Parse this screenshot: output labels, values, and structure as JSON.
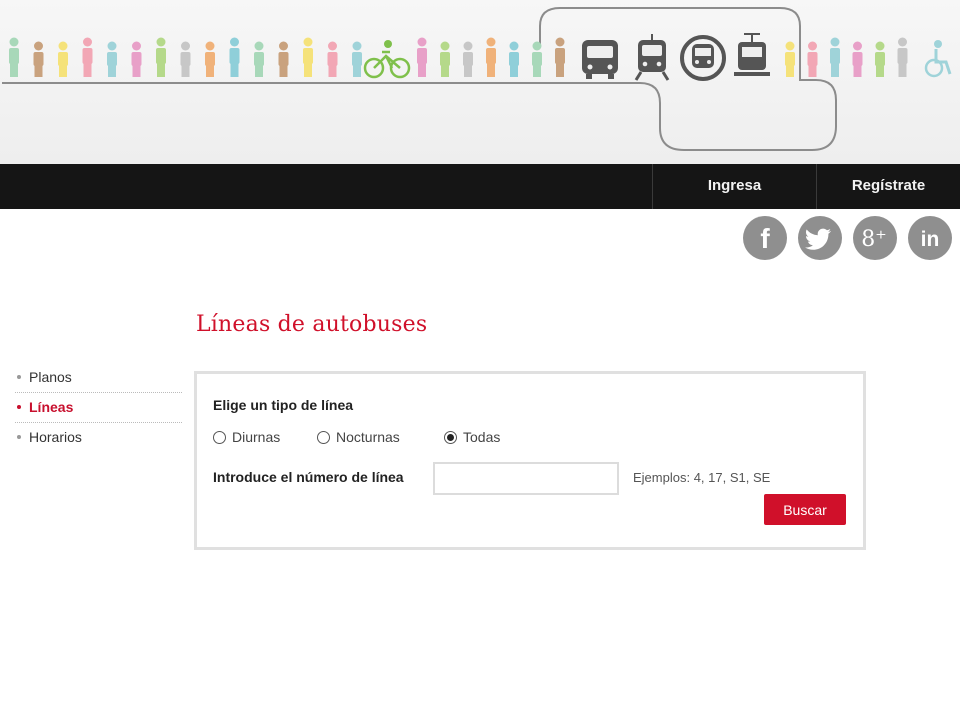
{
  "header": {
    "banner_illustration": "people-and-transport-banner",
    "nav": {
      "ingresa": "Ingresa",
      "registrate": "Regístrate"
    }
  },
  "social": {
    "icons": [
      "facebook-icon",
      "twitter-icon",
      "google-plus-icon",
      "linkedin-icon"
    ],
    "gplus_text": "8⁺",
    "linkedin_text": "in",
    "facebook_text": "f"
  },
  "page": {
    "title": "Líneas de autobuses"
  },
  "sidebar": {
    "items": [
      {
        "label": "Planos",
        "active": false
      },
      {
        "label": "Líneas",
        "active": true
      },
      {
        "label": "Horarios",
        "active": false
      }
    ]
  },
  "form": {
    "heading": "Elige un tipo de línea",
    "options": [
      {
        "label": "Diurnas",
        "checked": false
      },
      {
        "label": "Nocturnas",
        "checked": false
      },
      {
        "label": "Todas",
        "checked": true
      }
    ],
    "number_label": "Introduce el número de línea",
    "number_value": "",
    "examples": "Ejemplos: 4, 17, S1, SE",
    "submit_label": "Buscar"
  },
  "colors": {
    "accent": "#d0102a",
    "topbar": "#151515",
    "social": "#8f8f8f"
  }
}
